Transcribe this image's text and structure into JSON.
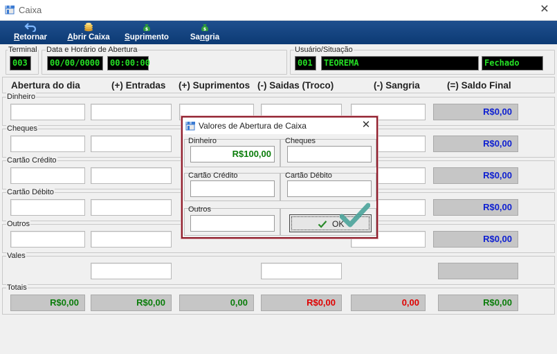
{
  "window": {
    "title": "Caixa",
    "close_glyph": "✕"
  },
  "toolbar": {
    "retornar_first": "R",
    "retornar_rest": "etornar",
    "abrir_first": "A",
    "abrir_rest": "brir Caixa",
    "suprimento_first": "S",
    "suprimento_rest": "uprimento",
    "sangria_a": "Sa",
    "sangria_n": "n",
    "sangria_rest": "gria",
    "icons": [
      "back-arrow-icon",
      "coins-stack-icon",
      "money-bag-icon",
      "money-bag-icon"
    ]
  },
  "info": {
    "terminal_label": "Terminal",
    "terminal_value": "003",
    "data_label": "Data e Horário de Abertura",
    "date_value": "00/00/0000",
    "time_value": "00:00:00",
    "usuario_label": "Usuário/Situação",
    "user_id": "001",
    "user_name": "TEOREMA",
    "status": "Fechado"
  },
  "columns": [
    "Abertura do dia",
    "(+) Entradas",
    "(+) Suprimentos",
    "(-) Saidas (Troco)",
    "(-) Sangria",
    "(=) Saldo Final"
  ],
  "rows": [
    {
      "label": "Dinheiro",
      "saldo": "R$0,00"
    },
    {
      "label": "Cheques",
      "saldo": "R$0,00"
    },
    {
      "label": "Cartão Crédito",
      "saldo": "R$0,00"
    },
    {
      "label": "Cartão Débito",
      "saldo": "R$0,00"
    },
    {
      "label": "Outros",
      "saldo": "R$0,00"
    },
    {
      "label": "Vales"
    }
  ],
  "totais": {
    "label": "Totais",
    "values": [
      "R$0,00",
      "R$0,00",
      "0,00",
      "R$0,00",
      "0,00",
      "R$0,00"
    ]
  },
  "colors": {
    "toolbar": "#0c3a74",
    "lcd_text": "#25e025",
    "saldo_blue": "#0d1fd1",
    "total_green": "#0a7d0a",
    "total_red": "#e00000",
    "modal_border": "#8f1d2b"
  },
  "modal": {
    "title": "Valores de Abertura de Caixa",
    "close_glyph": "✕",
    "dinheiro_label": "Dinheiro",
    "dinheiro_value": "R$100,00",
    "cheques_label": "Cheques",
    "cheques_value": "",
    "credito_label": "Cartão Crédito",
    "credito_value": "",
    "debito_label": "Cartão Débito",
    "debito_value": "",
    "outros_label": "Outros",
    "outros_value": "",
    "ok_label": "OK"
  }
}
